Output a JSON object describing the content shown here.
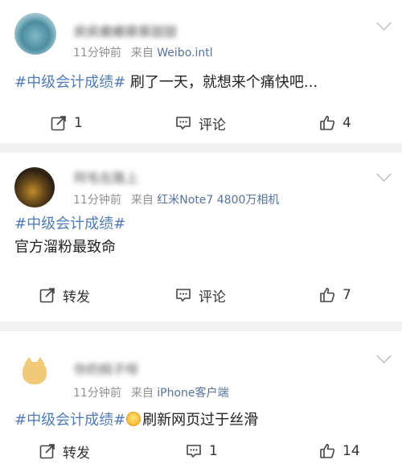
{
  "posts": [
    {
      "username": "疯疯癫癫蔡蔡甜甜",
      "time": "11分钟前",
      "source_prefix": "来自",
      "source": "Weibo.intl",
      "hashtag": "#中级会计成绩#",
      "text": "刷了一天，就想来个痛快吧...",
      "repost_label": "1",
      "comment_label": "评论",
      "like_count": "4"
    },
    {
      "username": "阿毛在路上",
      "time": "11分钟前",
      "source_prefix": "来自",
      "source": "红米Note7 4800万相机",
      "hashtag": "#中级会计成绩#",
      "text": "官方溜粉最致命",
      "repost_label": "转发",
      "comment_label": "评论",
      "like_count": "7"
    },
    {
      "username": "你的桃子呀",
      "time": "11分钟前",
      "source_prefix": "来自",
      "source": "iPhone客户端",
      "hashtag": "#中级会计成绩#",
      "text": "刷新网页过于丝滑",
      "repost_label": "转发",
      "comment_label": "1",
      "like_count": "14"
    }
  ],
  "colors": {
    "link": "#4f7cb6",
    "source": "#56739b",
    "meta": "#909090",
    "background": "#f1f1f1"
  },
  "icons": [
    "chevron-down-icon",
    "repost-icon",
    "comment-icon",
    "thumbs-up-icon",
    "emoji-icon"
  ]
}
